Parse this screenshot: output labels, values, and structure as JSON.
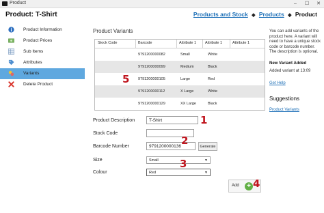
{
  "window": {
    "title": "Product"
  },
  "header": {
    "page_title": "Product: T-Shirt",
    "breadcrumb": {
      "link1": "Products and Stock",
      "link2": "Products",
      "current": "Product"
    }
  },
  "sidebar": {
    "items": [
      {
        "label": "Product Information",
        "icon": "info-icon"
      },
      {
        "label": "Product Prices",
        "icon": "money-icon"
      },
      {
        "label": "Sub Items",
        "icon": "grid-icon"
      },
      {
        "label": "Attributes",
        "icon": "tag-icon"
      },
      {
        "label": "Variants",
        "icon": "variants-icon",
        "selected": true
      },
      {
        "label": "Delete Product",
        "icon": "delete-icon"
      }
    ]
  },
  "main": {
    "heading": "Product Variants",
    "table": {
      "columns": [
        "Stock Code",
        "Barcode",
        "Attribute 1",
        "Attribute 1",
        "Attribute 1"
      ],
      "rows": [
        [
          "",
          "9791200000082",
          "Small",
          "White",
          ""
        ],
        [
          "",
          "9791200000099",
          "Medium",
          "Black",
          ""
        ],
        [
          "",
          "9791200000105",
          "Large",
          "Red",
          ""
        ],
        [
          "",
          "9791200000112",
          "X Large",
          "White",
          ""
        ],
        [
          "",
          "9791200000129",
          "XX Large",
          "Black",
          ""
        ]
      ]
    },
    "form": {
      "product_description_label": "Product Description",
      "product_description_value": "T-Shirt",
      "stock_code_label": "Stock Code",
      "stock_code_value": "",
      "barcode_label": "Barcode Number",
      "barcode_value": "9791200000136",
      "generate_label": "Generate",
      "size_label": "Size",
      "size_value": "Small",
      "colour_label": "Colour",
      "colour_value": "Red"
    },
    "add_label": "Add",
    "callouts": [
      "1",
      "2",
      "3",
      "4",
      "5"
    ]
  },
  "right_panel": {
    "help_text": "You can add variants of the product here. A variant will need to have a unique stock code or barcode number. The description is optional.",
    "new_variant_title": "New Variant Added",
    "new_variant_msg": "Added variant at 13:09",
    "get_help": "Get Help",
    "suggestions_title": "Suggestions",
    "suggestion_link": "Product Variants"
  },
  "colors": {
    "accent": "#1c6fb7",
    "selected_bg": "#5fa8df",
    "callout": "#c0151e",
    "add_green": "#62b046"
  }
}
